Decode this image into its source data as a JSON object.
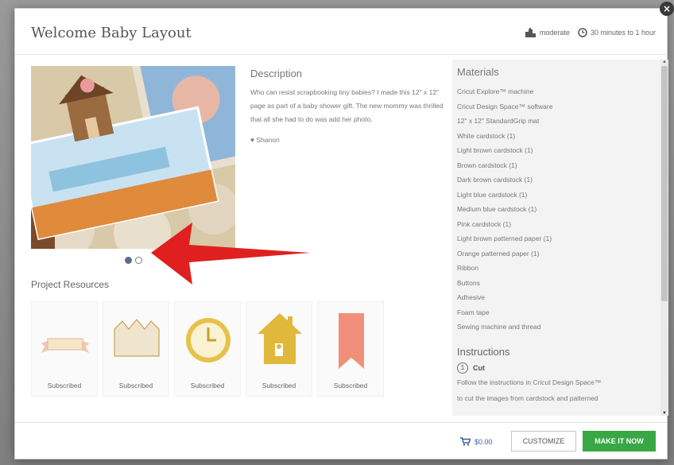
{
  "modal": {
    "title": "Welcome Baby Layout",
    "difficulty": "moderate",
    "duration": "30 minutes to 1 hour",
    "close_label": "×"
  },
  "description": {
    "heading": "Description",
    "text": "Who can resist scrapbooking tiny babies? I made this 12\" x 12\" page as part of a baby shower gift. The new mommy was thrilled that all she had to do was add her photo.",
    "author": "Shanon"
  },
  "materials": {
    "heading": "Materials",
    "items": [
      "Cricut Explore™ machine",
      "Cricut Design Space™ software",
      "12\" x 12\" StandardGrip mat",
      "White cardstock (1)",
      "Light brown cardstock (1)",
      "Brown cardstock (1)",
      "Dark brown cardstock (1)",
      "Light blue cardstock (1)",
      "Medium blue cardstock (1)",
      "Pink cardstock (1)",
      "Light brown patterned paper (1)",
      "Orange patterned paper (1)",
      "Ribbon",
      "Buttons",
      "Adhesive",
      "Foam tape",
      "Sewing machine and thread"
    ]
  },
  "instructions": {
    "heading": "Instructions",
    "step_number": "1",
    "step_title": "Cut",
    "step_text_1": "Follow the instructions in Cricut Design Space™",
    "step_text_2": "to cut the images from cardstock and patterned"
  },
  "resources": {
    "heading": "Project Resources",
    "items": [
      {
        "icon": "banner-icon",
        "label": "Subscribed"
      },
      {
        "icon": "crown-icon",
        "label": "Subscribed"
      },
      {
        "icon": "clock-icon",
        "label": "Subscribed"
      },
      {
        "icon": "house-icon",
        "label": "Subscribed"
      },
      {
        "icon": "pennant-icon",
        "label": "Subscribed"
      }
    ]
  },
  "footer": {
    "price": "$0.00",
    "customize_label": "CUSTOMIZE",
    "make_label": "MAKE IT NOW"
  },
  "colors": {
    "make_button": "#38a845",
    "price_link": "#3a5ea0",
    "annotation_arrow": "#e02020"
  }
}
